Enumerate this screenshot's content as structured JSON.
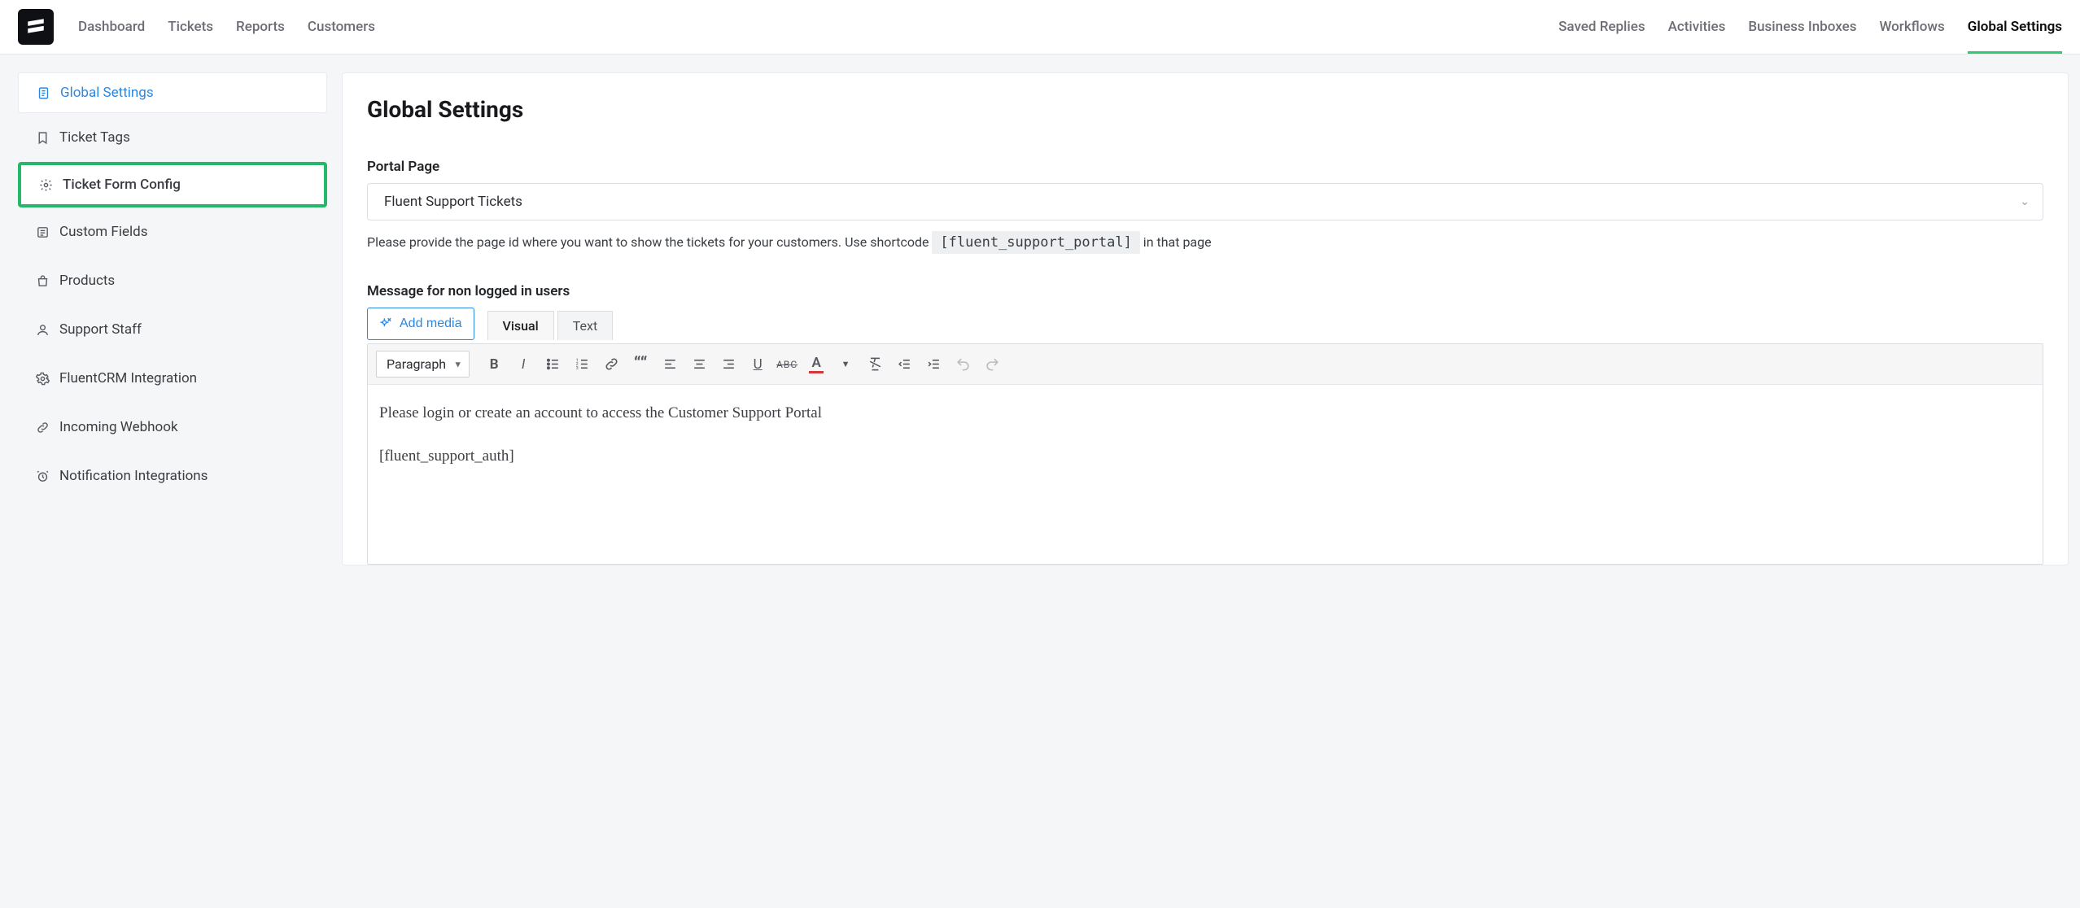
{
  "nav": {
    "left": [
      "Dashboard",
      "Tickets",
      "Reports",
      "Customers"
    ],
    "right": [
      "Saved Replies",
      "Activities",
      "Business Inboxes",
      "Workflows",
      "Global Settings"
    ],
    "active_right_index": 4
  },
  "sidebar": {
    "items": [
      {
        "label": "Global Settings",
        "icon": "document-icon",
        "variant": "primary-top"
      },
      {
        "label": "Ticket Tags",
        "icon": "bookmark-icon"
      },
      {
        "label": "Ticket Form Config",
        "icon": "gear-icon",
        "selected": true
      },
      {
        "label": "Custom Fields",
        "icon": "list-icon"
      },
      {
        "label": "Products",
        "icon": "bag-icon"
      },
      {
        "label": "Support Staff",
        "icon": "person-icon"
      },
      {
        "label": "FluentCRM Integration",
        "icon": "cog-icon"
      },
      {
        "label": "Incoming Webhook",
        "icon": "link-icon"
      },
      {
        "label": "Notification Integrations",
        "icon": "clock-icon"
      }
    ]
  },
  "main": {
    "title": "Global Settings",
    "portal_label": "Portal Page",
    "portal_value": "Fluent Support Tickets",
    "portal_help_pre": "Please provide the page id where you want to show the tickets for your customers. Use shortcode ",
    "portal_help_code": "[fluent_support_portal]",
    "portal_help_post": " in that page",
    "message_label": "Message for non logged in users",
    "add_media_label": "Add media",
    "tab_visual": "Visual",
    "tab_text": "Text",
    "format_label": "Paragraph",
    "editor_lines": [
      "Please login or create an account to access the Customer Support Portal",
      "[fluent_support_auth]"
    ]
  },
  "toolbar_icons": [
    "bold",
    "italic",
    "ul",
    "ol",
    "link",
    "quote",
    "align-left",
    "align-center",
    "align-right",
    "underline",
    "strike",
    "text-color",
    "clear-format",
    "outdent",
    "indent",
    "undo",
    "redo"
  ]
}
